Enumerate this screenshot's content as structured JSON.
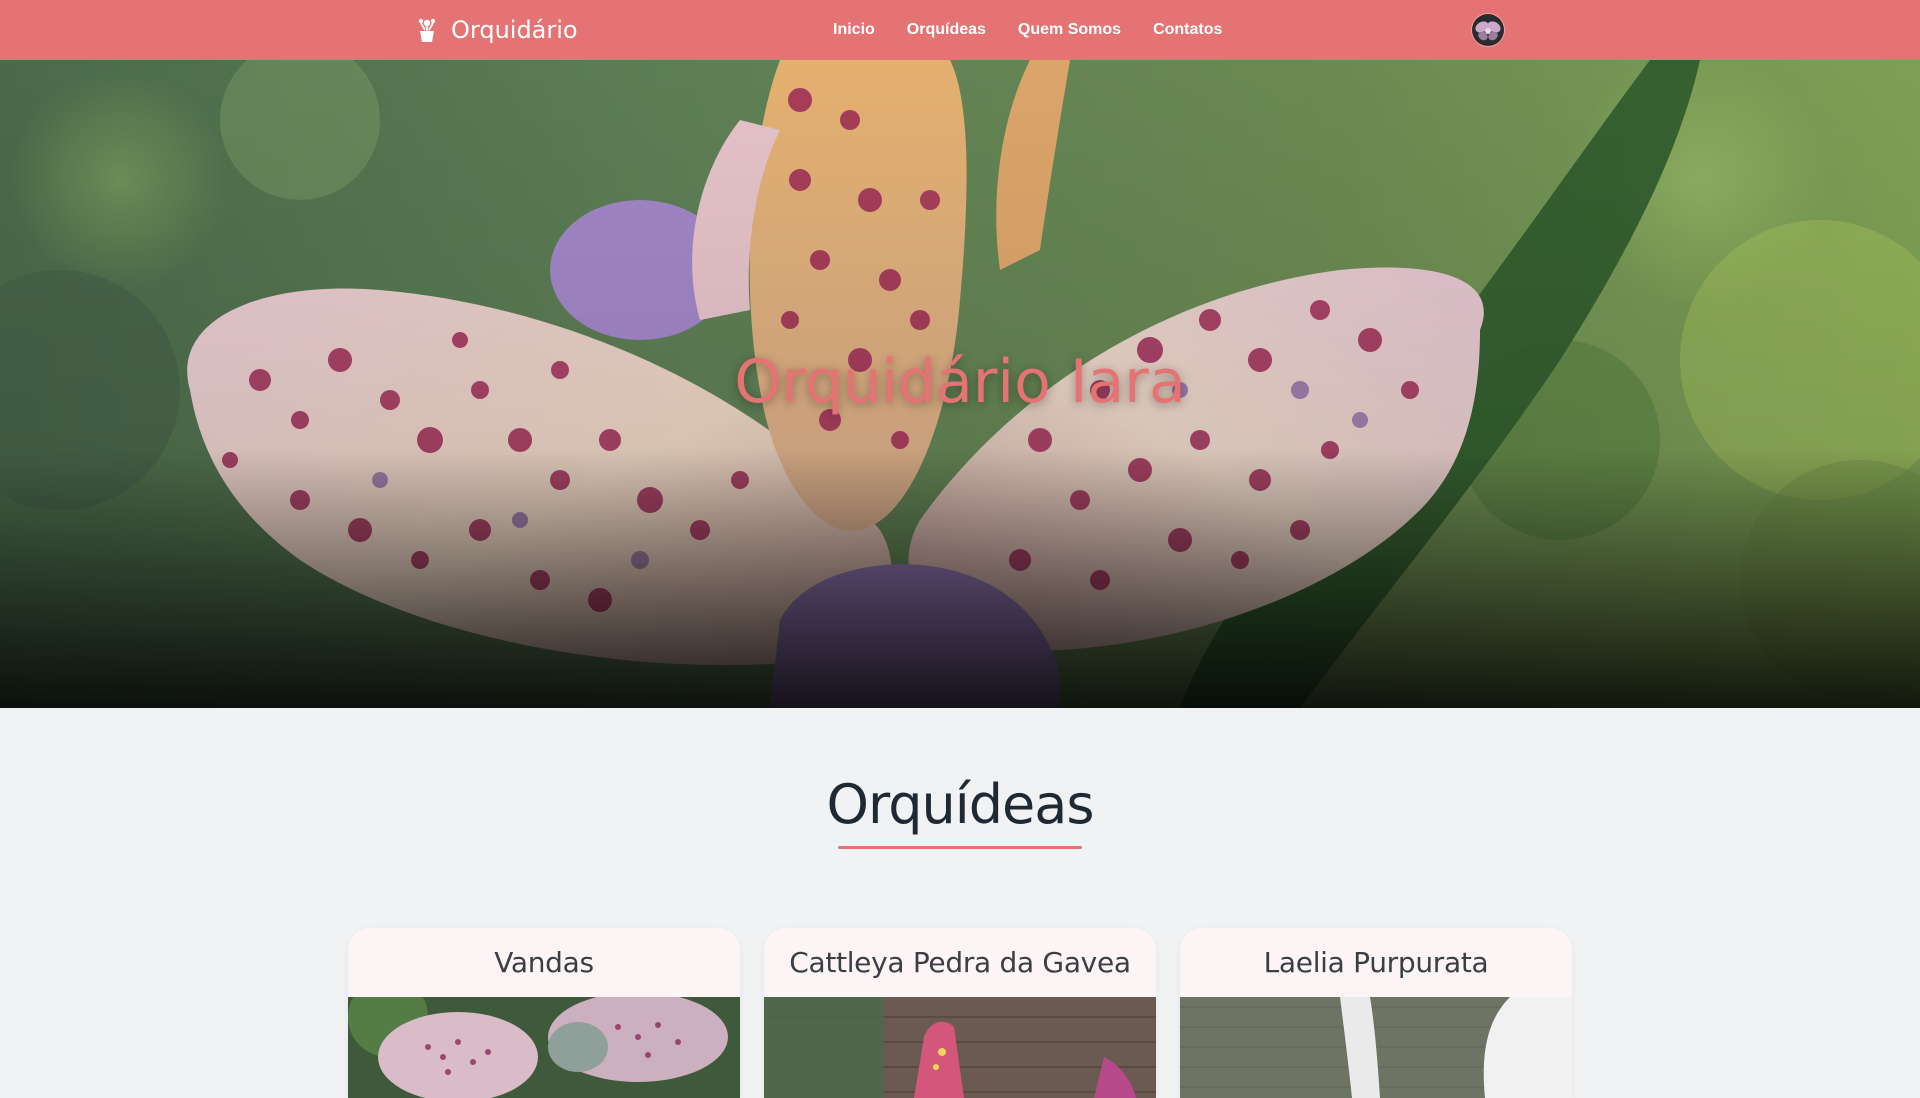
{
  "navbar": {
    "brand": "Orquidário",
    "brand_icon": "flower-pot-icon",
    "links": [
      "Inicio",
      "Orquídeas",
      "Quem Somos",
      "Contatos"
    ],
    "avatar_icon": "orchid-avatar-icon",
    "background_color": "#e57373"
  },
  "hero": {
    "title": "Orquidário Iara",
    "title_color": "#e57373"
  },
  "section": {
    "title": "Orquídeas",
    "underline_color": "#e57373"
  },
  "cards": [
    {
      "title": "Vandas"
    },
    {
      "title": "Cattleya Pedra da Gavea"
    },
    {
      "title": "Laelia Purpurata"
    }
  ]
}
